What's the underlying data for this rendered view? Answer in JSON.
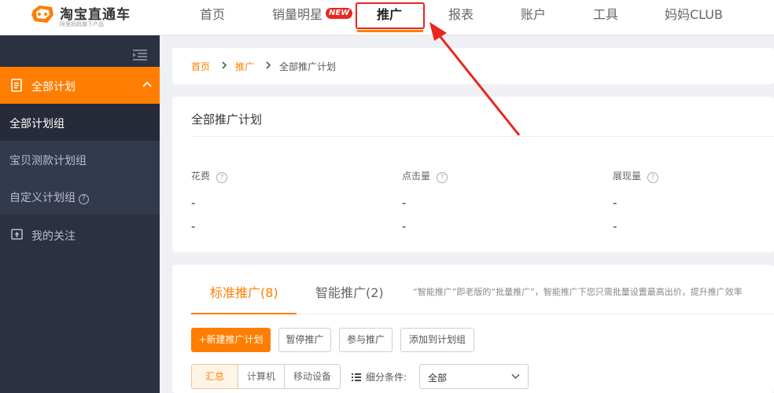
{
  "header": {
    "logo_title": "淘宝直通车",
    "logo_sub": "阿里妈妈旗下产品",
    "nav": [
      {
        "label": "首页"
      },
      {
        "label": "销量明星",
        "badge": "NEW"
      },
      {
        "label": "推广",
        "active": true
      },
      {
        "label": "报表"
      },
      {
        "label": "账户"
      },
      {
        "label": "工具"
      },
      {
        "label": "妈妈CLUB"
      }
    ]
  },
  "sidebar": {
    "section_label": "全部计划",
    "items": [
      {
        "label": "全部计划组"
      },
      {
        "label": "宝贝测款计划组"
      },
      {
        "label": "自定义计划组",
        "help": "?"
      },
      {
        "label": "我的关注"
      }
    ]
  },
  "breadcrumb": {
    "items": [
      "首页",
      "推广",
      "全部推广计划"
    ]
  },
  "stats": {
    "title": "全部推广计划",
    "help": "?",
    "metrics": [
      {
        "label": "花费",
        "v1": "-",
        "v2": "-"
      },
      {
        "label": "点击量",
        "v1": "-",
        "v2": "-"
      },
      {
        "label": "展现量",
        "v1": "-",
        "v2": "-"
      }
    ]
  },
  "plans": {
    "tabs": [
      {
        "label": "标准推广(8)",
        "active": true
      },
      {
        "label": "智能推广(2)"
      }
    ],
    "tab_note": "“智能推广”即老版的“批量推广”，智能推广下您只需批量设置最高出价，提升推广效率",
    "buttons": [
      "+新建推广计划",
      "暂停推广",
      "参与推广",
      "添加到计划组"
    ],
    "segments": [
      "汇总",
      "计算机",
      "移动设备"
    ],
    "filter_label": "细分条件:",
    "filter_value": "全部"
  },
  "colors": {
    "accent": "#ff7d00",
    "sidebar": "#2c3142",
    "annotation": "#e8261e"
  }
}
